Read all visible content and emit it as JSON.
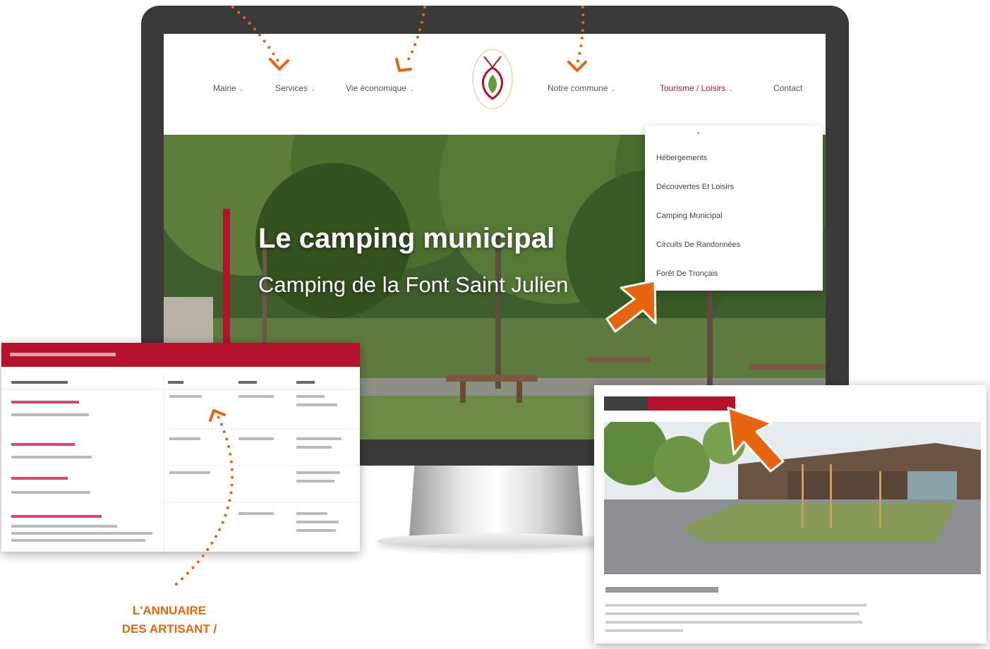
{
  "nav": {
    "items": [
      {
        "label": "Mairie",
        "caret": "⌄"
      },
      {
        "label": "Services",
        "caret": "⌄"
      },
      {
        "label": "Vie économique",
        "caret": "⌄"
      },
      {
        "label": "Notre commune",
        "caret": "⌄"
      },
      {
        "label": "Tourisme / Loisirs",
        "caret": "⌄",
        "active": true
      },
      {
        "label": "Contact"
      }
    ]
  },
  "hero": {
    "title": "Le camping municipal",
    "subtitle": "Camping de la Font Saint Julien"
  },
  "dropdown": {
    "items": [
      "Hébergements",
      "Découvertes Et Loisirs",
      "Camping Municipal",
      "Circuits De Randonnées",
      "Forêt De Tronçais"
    ]
  },
  "annotation": {
    "line1": "L'ANNUAIRE",
    "line2": "DES ARTISANT /"
  },
  "colors": {
    "accent_red": "#b5122b",
    "annotation_orange": "#e8650f",
    "monitor_frame": "#3a3a3a"
  }
}
